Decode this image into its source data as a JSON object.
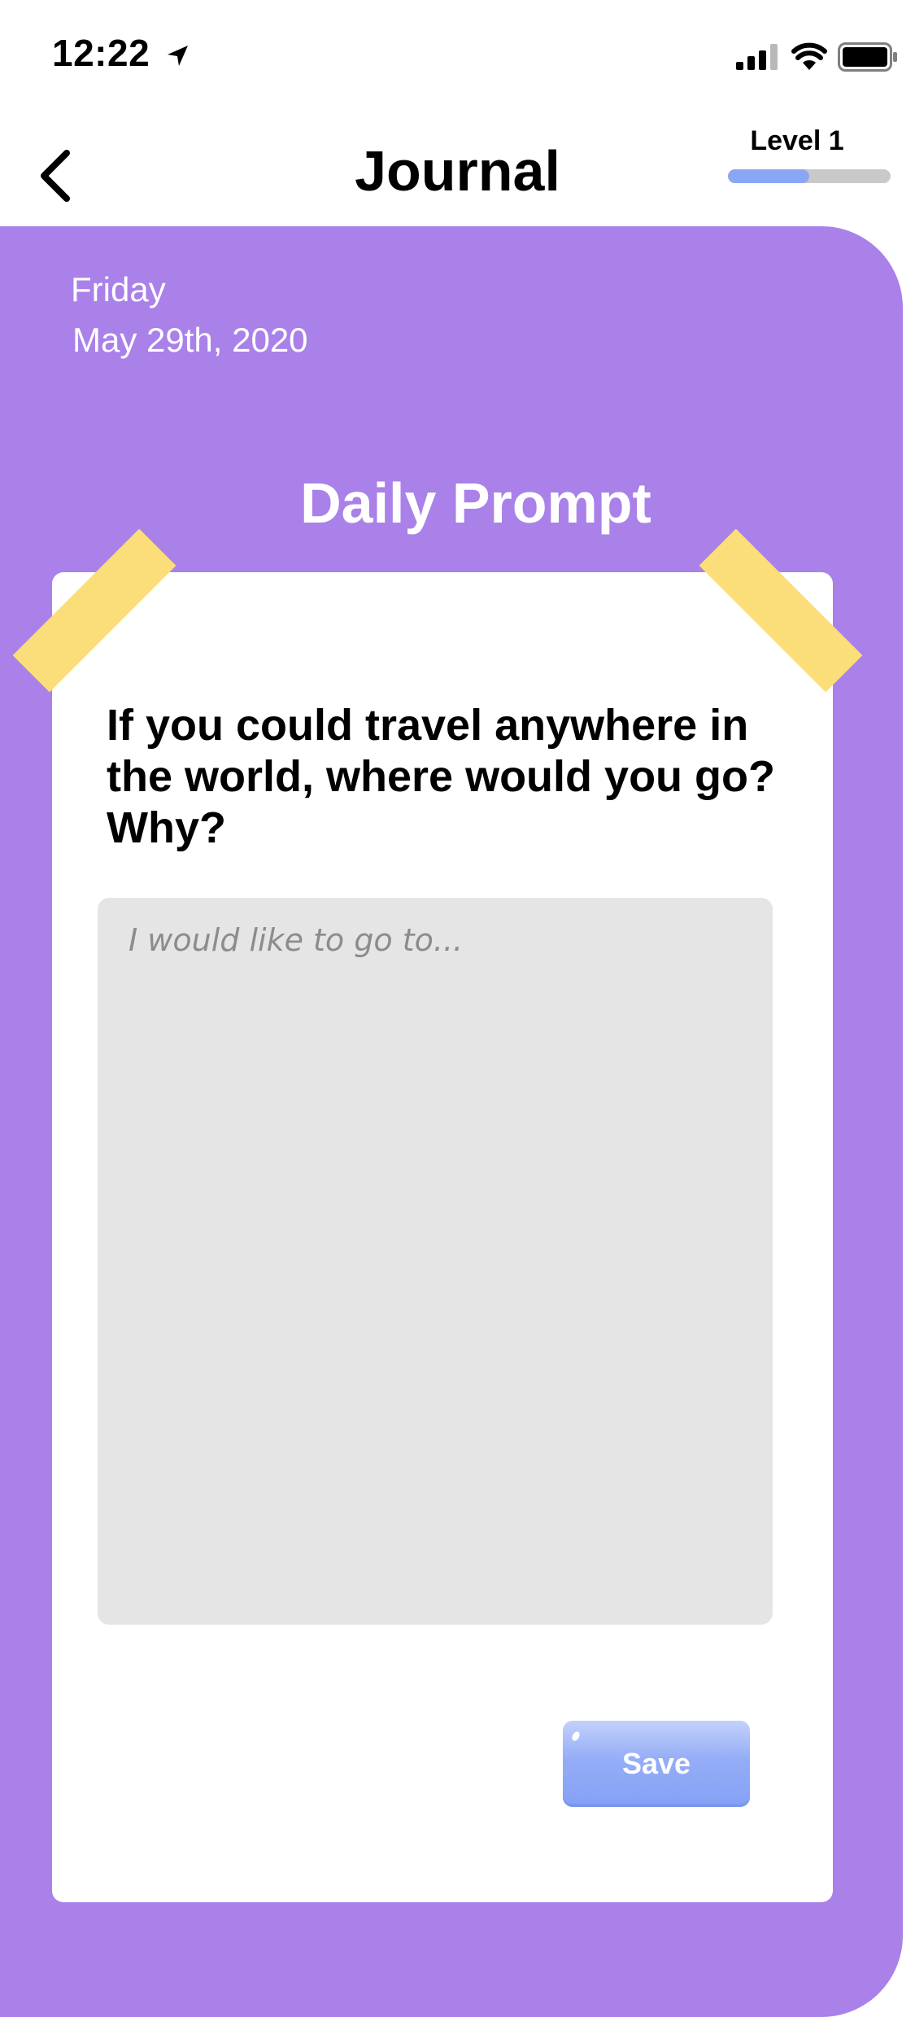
{
  "status_bar": {
    "time": "12:22",
    "icons": [
      "location-arrow-icon",
      "cellular-signal-icon",
      "wifi-icon",
      "battery-icon"
    ]
  },
  "header": {
    "title": "Journal",
    "back_icon": "chevron-left-icon",
    "level": {
      "label": "Level 1",
      "progress_fraction": 0.5
    }
  },
  "entry": {
    "day": "Friday",
    "date": "May 29th, 2020"
  },
  "prompt": {
    "heading": "Daily Prompt",
    "question": "If you could travel anywhere in the world, where would you go? Why?",
    "answer_value": "",
    "answer_placeholder": "I would like to go to...",
    "save_label": "Save"
  },
  "colors": {
    "panel": "#a981e9",
    "card": "#ffffff",
    "tape": "#fbdd7a",
    "input_bg": "#e5e5e5",
    "accent": "#8aa7f6",
    "level_track": "#c9c9c9"
  }
}
